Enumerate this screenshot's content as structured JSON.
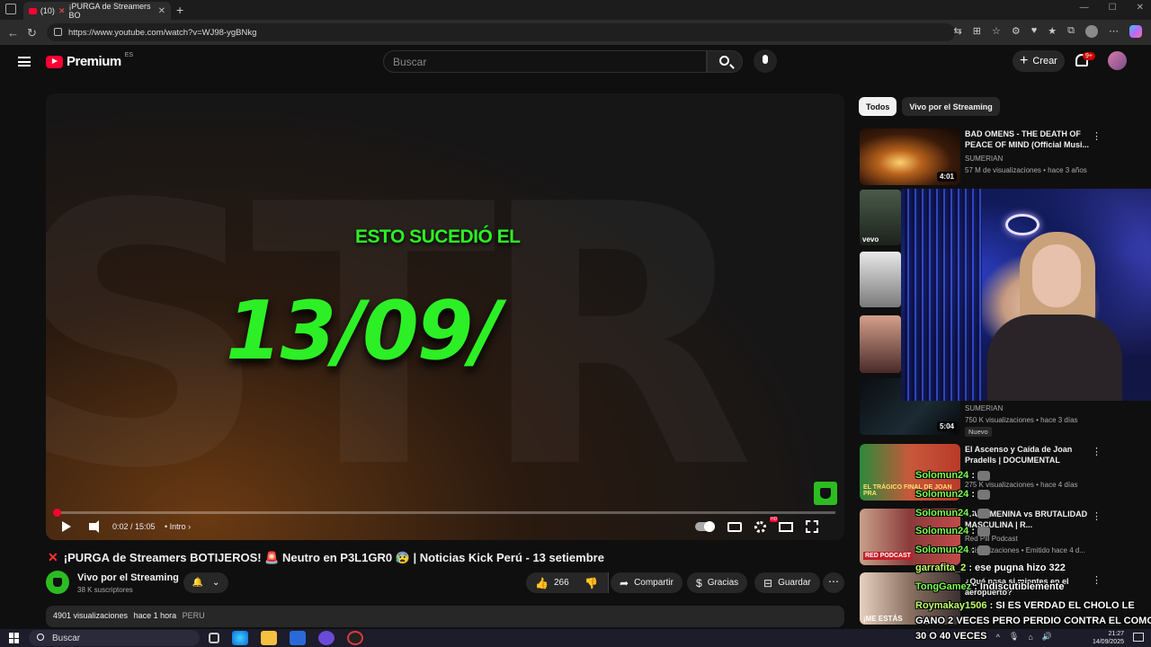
{
  "browser": {
    "tab_count": "(10)",
    "tab_title": "¡PURGA de Streamers BO",
    "url": "https://www.youtube.com/watch?v=WJ98-ygBNkg"
  },
  "header": {
    "logo_word": "Premium",
    "country": "ES",
    "search_placeholder": "Buscar",
    "create_label": "Crear",
    "notif_badge": "9+"
  },
  "video": {
    "overlay_subtitle": "ESTO SUCEDIÓ EL",
    "overlay_date": "13/09/",
    "time": "0:02 / 15:05",
    "chapter": "• Intro",
    "progress_fraction": 0.002,
    "title": "¡PURGA de Streamers BOTIJEROS! 🚨 Neutro en P3L1GR0 😰 | Noticias Kick Perú - 13 setiembre",
    "channel": "Vivo por el Streaming",
    "subscribers": "38 K suscriptores",
    "likes": "266",
    "share_label": "Compartir",
    "thanks_label": "Gracias",
    "save_label": "Guardar",
    "views": "4901 visualizaciones",
    "posted": "hace 1 hora",
    "location": "PERU"
  },
  "sidebar": {
    "chips": [
      "Todos",
      "Vivo por el Streaming"
    ],
    "recs": [
      {
        "title": "BAD OMENS - THE DEATH OF PEACE OF MIND (Official Musi...",
        "channel": "SUMERIAN",
        "meta": "57 M de visualizaciones • hace 3 años",
        "duration": "4:01"
      },
      {
        "channel": "SUMERIAN",
        "meta": "750 K visualizaciones • hace 3 días",
        "duration": "5:04",
        "badge": "Nuevo"
      },
      {
        "title": "El Ascenso y Caída de Joan Pradells | DOCUMENTAL",
        "meta": "275 K visualizaciones • hace 4 días"
      },
      {
        "title": "...A FEMENINA vs BRUTALIDAD MASCULINA | R...",
        "channel": "Red Pill Podcast",
        "meta": "...visualizaciones • Emitido hace 4 d..."
      },
      {
        "title": "¿Qué pasa si mientes en el aeropuerto?"
      }
    ],
    "thumb_labels": [
      "vevo",
      "RED PODCAST",
      "EL TRÁGICO FINAL DE JOAN PRA",
      "¡ME ESTÁS"
    ]
  },
  "chat": [
    {
      "user": "Solomun24",
      "msg": ":"
    },
    {
      "user": "Solomun24",
      "msg": ":"
    },
    {
      "user": "Solomun24",
      "msg": ":"
    },
    {
      "user": "Solomun24",
      "msg": ":"
    },
    {
      "user": "Solomun24",
      "msg": ":"
    },
    {
      "user": "garrafita_2",
      "msg": ": ese pugna hizo 322"
    },
    {
      "user": "TongGamez",
      "msg": ": Indiscutiblemente"
    },
    {
      "user": "Roymakay1506",
      "msg": ": SI ES VERDAD EL CHOLO LE"
    },
    {
      "user": "",
      "msg": "GANO 2 VECES PERO PERDIO CONTRA EL COMO"
    },
    {
      "user": "",
      "msg": "30 O 40 VECES"
    }
  ],
  "taskbar": {
    "search_label": "Buscar",
    "time": "21:27",
    "date": "14/09/2025"
  },
  "colors": {
    "yt_red": "#ff0033",
    "overlay_green": "#2cf025",
    "chat_user_green": "#7cff52"
  }
}
